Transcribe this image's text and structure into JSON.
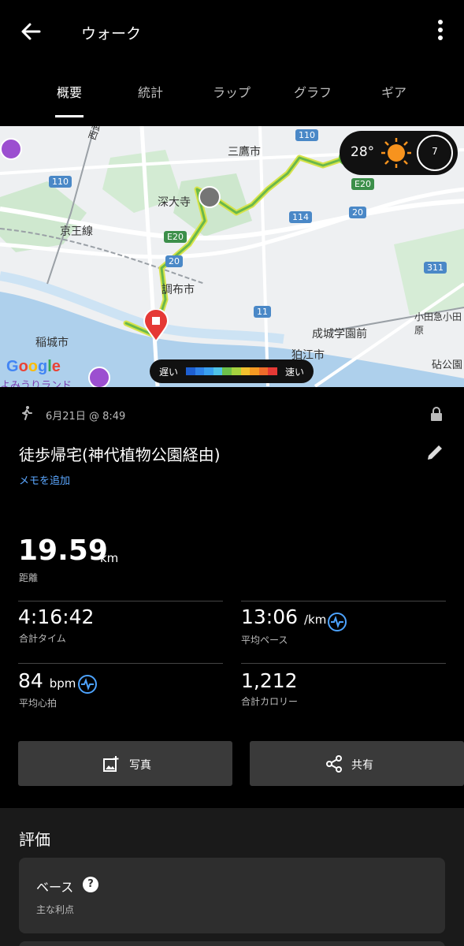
{
  "header": {
    "title": "ウォーク"
  },
  "tabs": [
    {
      "label": "概要"
    },
    {
      "label": "統計"
    },
    {
      "label": "ラップ"
    },
    {
      "label": "グラフ"
    },
    {
      "label": "ギア"
    }
  ],
  "map": {
    "labels": {
      "mitaka": "三鷹市",
      "jindaiji": "深大寺",
      "keio": "京王線",
      "chofu": "調布市",
      "inagi": "稲城市",
      "komae": "狛江市",
      "seijo": "成城学園前",
      "odakyu": "小田急小田原",
      "yomiuri": "よみうりランド",
      "tamagawa": "西武多摩川線",
      "kinuta": "砧公園"
    },
    "shields": {
      "r110a": "110",
      "r110b": "110",
      "e20a": "E20",
      "e20b": "E20",
      "r20a": "20",
      "r20b": "20",
      "r114": "114",
      "r311": "311",
      "r11": "11"
    },
    "weather": {
      "temp": "28°",
      "wind": "7"
    },
    "legend": {
      "slow": "遅い",
      "fast": "速い"
    },
    "google": "Google",
    "speed_colors": [
      "#1e5fd1",
      "#2f82e8",
      "#3aa0f0",
      "#4fc3e8",
      "#6cc04a",
      "#a5d23f",
      "#f2c12e",
      "#f59a23",
      "#ef6c2a",
      "#e53935"
    ]
  },
  "activity": {
    "datetime": "6月21日 @ 8:49",
    "name": "徒歩帰宅(神代植物公園経由)",
    "memo_link": "メモを追加"
  },
  "stats": {
    "distance": {
      "value": "19.59",
      "unit": "km",
      "label": "距離"
    },
    "total_time": {
      "value": "4:16:42",
      "label": "合計タイム"
    },
    "avg_pace": {
      "value": "13:06",
      "unit": "/km",
      "label": "平均ペース"
    },
    "avg_hr": {
      "value": "84",
      "unit": "bpm",
      "label": "平均心拍"
    },
    "calories": {
      "value": "1,212",
      "label": "合計カロリー"
    }
  },
  "buttons": {
    "photo": "写真",
    "share": "共有"
  },
  "evaluation": {
    "title": "評価",
    "card_name": "ベース",
    "card_sub": "主な利点"
  },
  "colors": {
    "accent": "#5ba7ff",
    "route": "#9ccc3b",
    "marker": "#e53935"
  }
}
